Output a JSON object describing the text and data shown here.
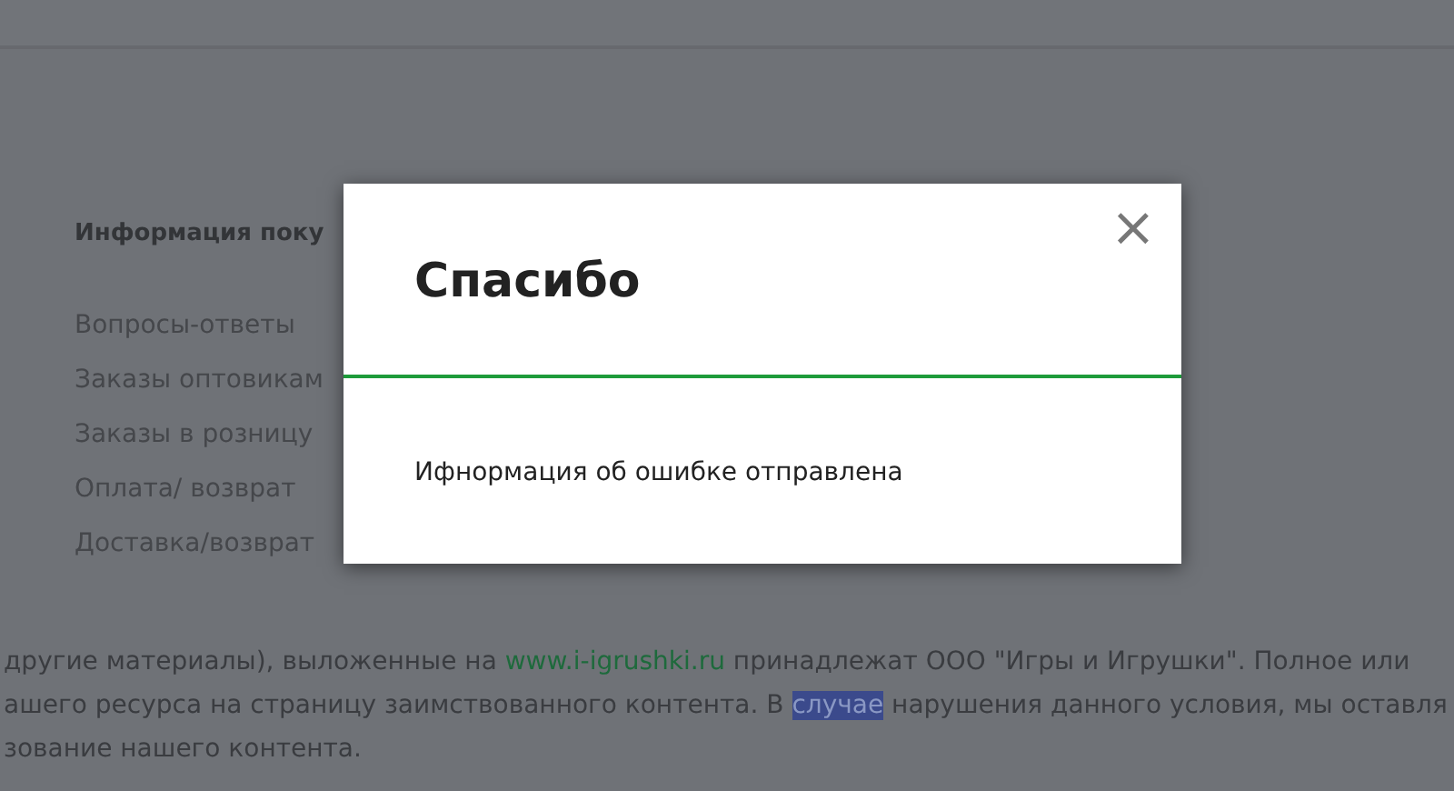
{
  "info_section": {
    "heading": "Информация поку",
    "links": [
      "Вопросы-ответы",
      "Заказы оптовикам",
      "Заказы в розницу",
      "Оплата/ возврат",
      "Доставка/возврат"
    ]
  },
  "paragraph": [
    [
      {
        "kind": "text",
        "text": "другие материалы), выложенные на "
      },
      {
        "kind": "link",
        "text": "www.i-igrushki.ru"
      },
      {
        "kind": "text",
        "text": " принадлежат ООО \"Игры и Игрушки\". Полное или"
      }
    ],
    [
      {
        "kind": "text",
        "text": "ашего ресурса на страницу заимствованного контента. В "
      },
      {
        "kind": "selected",
        "text": "случае"
      },
      {
        "kind": "text",
        "text": " нарушения данного условия, мы оставля"
      }
    ],
    [
      {
        "kind": "text",
        "text": "зование нашего контента."
      }
    ]
  ],
  "dialog": {
    "title": "Спасибо",
    "close": "×",
    "message": "Ифнормация об ошибке отправлена"
  }
}
